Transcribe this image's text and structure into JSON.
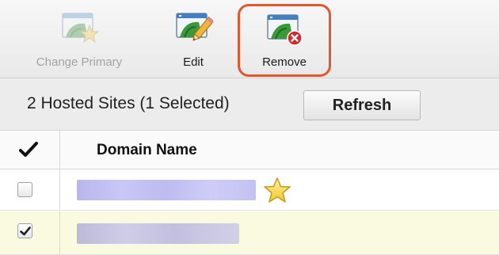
{
  "toolbar": {
    "change_primary_label": "Change Primary",
    "edit_label": "Edit",
    "remove_label": "Remove"
  },
  "summary": {
    "text": "2 Hosted Sites (1 Selected)",
    "refresh_label": "Refresh"
  },
  "grid": {
    "columns": [
      "",
      "Domain Name"
    ],
    "rows": [
      {
        "checked": false,
        "primary": true
      },
      {
        "checked": true,
        "primary": false
      }
    ]
  },
  "icons": {
    "change_primary": "window-star-icon",
    "edit": "window-pencil-icon",
    "remove": "window-remove-icon",
    "header_check": "checkmark-icon",
    "primary": "star-icon"
  },
  "colors": {
    "highlight_ring": "#e2572b",
    "selected_row": "#fafae0",
    "star": "#f3c623"
  }
}
